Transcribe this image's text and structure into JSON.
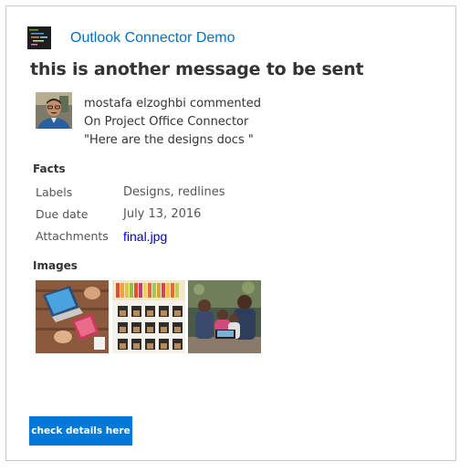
{
  "connector": {
    "name": "Outlook Connector Demo",
    "icon": "code-editor-icon"
  },
  "message": {
    "title": "this is another message to be sent"
  },
  "activity": {
    "avatar": "user-avatar-photo",
    "line1": "mostafa elzoghbi commented",
    "line2": "On Project Office Connector",
    "line3": "\"Here are the designs docs \""
  },
  "facts": {
    "title": "Facts",
    "items": [
      {
        "label": "Labels",
        "value": "Designs, redlines"
      },
      {
        "label": "Due date",
        "value": "July 13, 2016"
      },
      {
        "label": "Attachments",
        "value": "final.jpg"
      }
    ]
  },
  "images": {
    "title": "Images",
    "items": [
      {
        "alt": "laptop-desk-photo"
      },
      {
        "alt": "shelves-photo"
      },
      {
        "alt": "family-tablet-photo"
      }
    ]
  },
  "action": {
    "label": "check details here"
  },
  "colors": {
    "accent": "#0078d7",
    "connector_link": "#0072c6",
    "hyperlink": "#0000cc",
    "border": "#c8c8c8"
  }
}
